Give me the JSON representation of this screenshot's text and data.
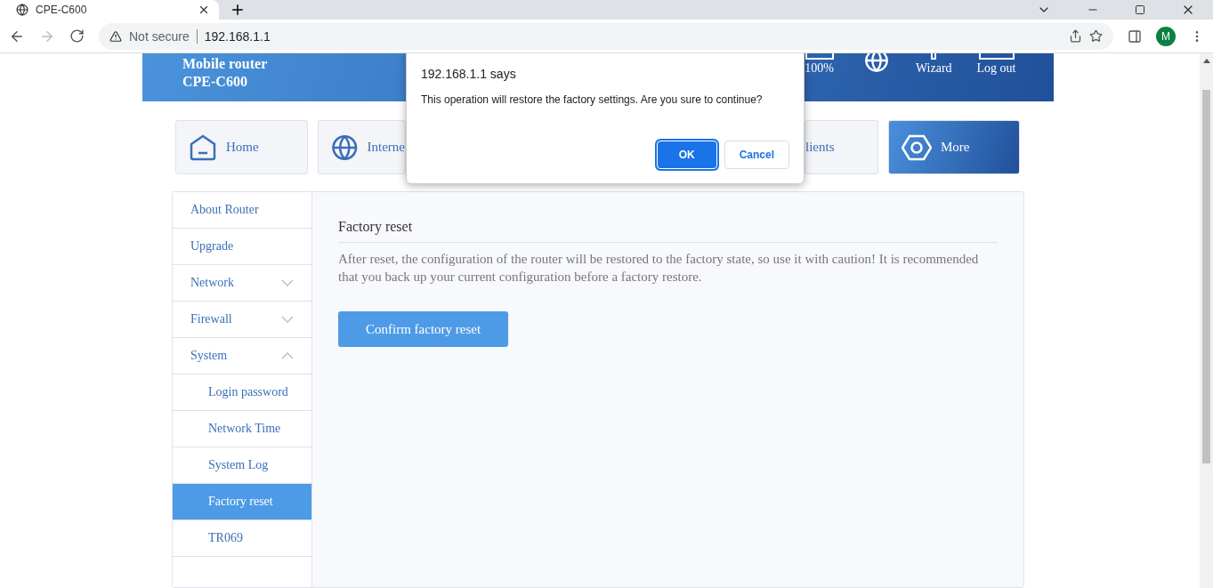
{
  "browser": {
    "tab_title": "CPE-C600",
    "security": "Not secure",
    "url": "192.168.1.1",
    "profile": "M"
  },
  "header": {
    "brand_line_1": "Mobile router",
    "brand_line_2": "CPE-C600",
    "battery": "100%",
    "actions": [
      "Wizard",
      "Log out"
    ]
  },
  "nav_tiles": [
    {
      "label": "Home",
      "kind": "home",
      "selected": false
    },
    {
      "label": "Interne",
      "kind": "globe",
      "selected": false
    },
    {
      "label": "lients",
      "kind": "plain",
      "selected": false
    },
    {
      "label": "More",
      "kind": "hexagon",
      "selected": true
    }
  ],
  "sidebar": {
    "items": [
      {
        "label": "About Router",
        "selected": false
      },
      {
        "label": "Upgrade",
        "selected": false
      },
      {
        "label": "Network",
        "kind": "group",
        "expanded": false
      },
      {
        "label": "Firewall",
        "kind": "group",
        "expanded": false
      },
      {
        "label": "System",
        "kind": "group",
        "expanded": true,
        "children": [
          {
            "label": "Login password",
            "selected": false
          },
          {
            "label": "Network Time",
            "selected": false
          },
          {
            "label": "System Log",
            "selected": false
          },
          {
            "label": "Factory reset",
            "selected": true
          },
          {
            "label": "TR069",
            "selected": false
          }
        ]
      }
    ]
  },
  "content": {
    "title": "Factory reset",
    "description": "After reset, the configuration of the router will be restored to the factory state, so use it with caution! It is recommended that you back up your current configuration before a factory restore.",
    "button": "Confirm factory reset"
  },
  "dialog": {
    "title": "192.168.1.1 says",
    "message": "This operation will restore the factory settings. Are you sure to continue?",
    "buttons": [
      {
        "label": "OK",
        "selected": true
      },
      {
        "label": "Cancel",
        "selected": false
      }
    ]
  }
}
